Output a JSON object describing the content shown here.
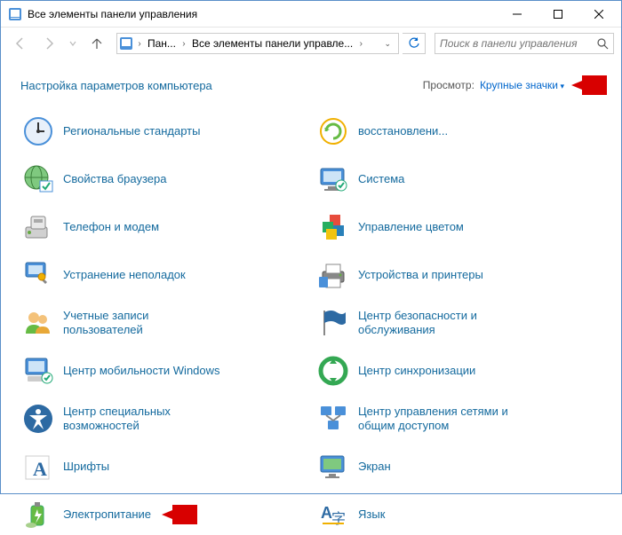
{
  "window": {
    "title": "Все элементы панели управления"
  },
  "breadcrumb": {
    "item1": "Пан...",
    "item2": "Все элементы панели управле..."
  },
  "search": {
    "placeholder": "Поиск в панели управления"
  },
  "header": {
    "title": "Настройка параметров компьютера",
    "view_label": "Просмотр:",
    "view_value": "Крупные значки"
  },
  "items": {
    "left": [
      "Региональные стандарты",
      "Свойства браузера",
      "Телефон и модем",
      "Устранение неполадок",
      "Учетные записи пользователей",
      "Центр мобильности Windows",
      "Центр специальных возможностей",
      "Шрифты",
      "Электропитание"
    ],
    "right": [
      "восстановлени...",
      "Система",
      "Управление цветом",
      "Устройства и принтеры",
      "Центр безопасности и обслуживания",
      "Центр синхронизации",
      "Центр управления сетями и общим доступом",
      "Экран",
      "Язык"
    ]
  }
}
